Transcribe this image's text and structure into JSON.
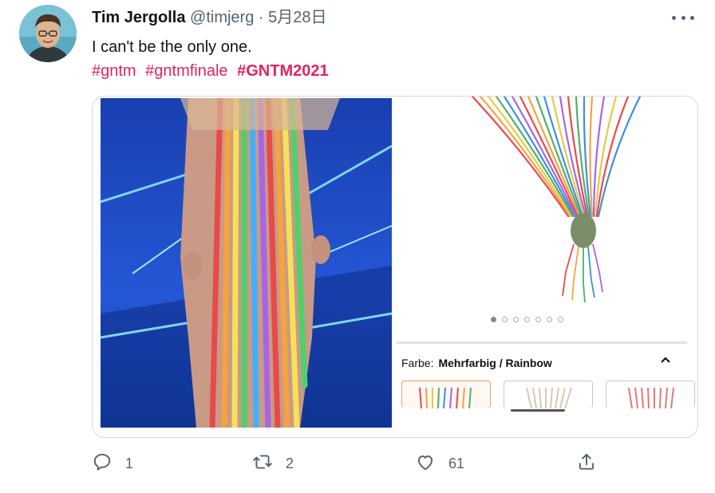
{
  "author": {
    "name": "Tim Jergolla",
    "handle": "@timjerg",
    "separator": "·",
    "date": "5月28日"
  },
  "tweet": {
    "text": "I can't be the only one.",
    "hashtags": [
      "#gntm",
      "#gntmfinale",
      "#GNTM2021"
    ]
  },
  "media": {
    "product": {
      "color_label": "Farbe:",
      "color_value": "Mehrfarbig / Rainbow",
      "carousel_dots": 7,
      "active_dot": 0
    }
  },
  "actions": {
    "reply_count": "1",
    "retweet_count": "2",
    "like_count": "61"
  },
  "colors": {
    "hashtag": "#e0245e",
    "secondary_text": "#536471",
    "border": "#cfd9de"
  },
  "icons": [
    "more-icon",
    "reply-icon",
    "retweet-icon",
    "like-icon",
    "share-icon",
    "chevron-up-icon"
  ]
}
